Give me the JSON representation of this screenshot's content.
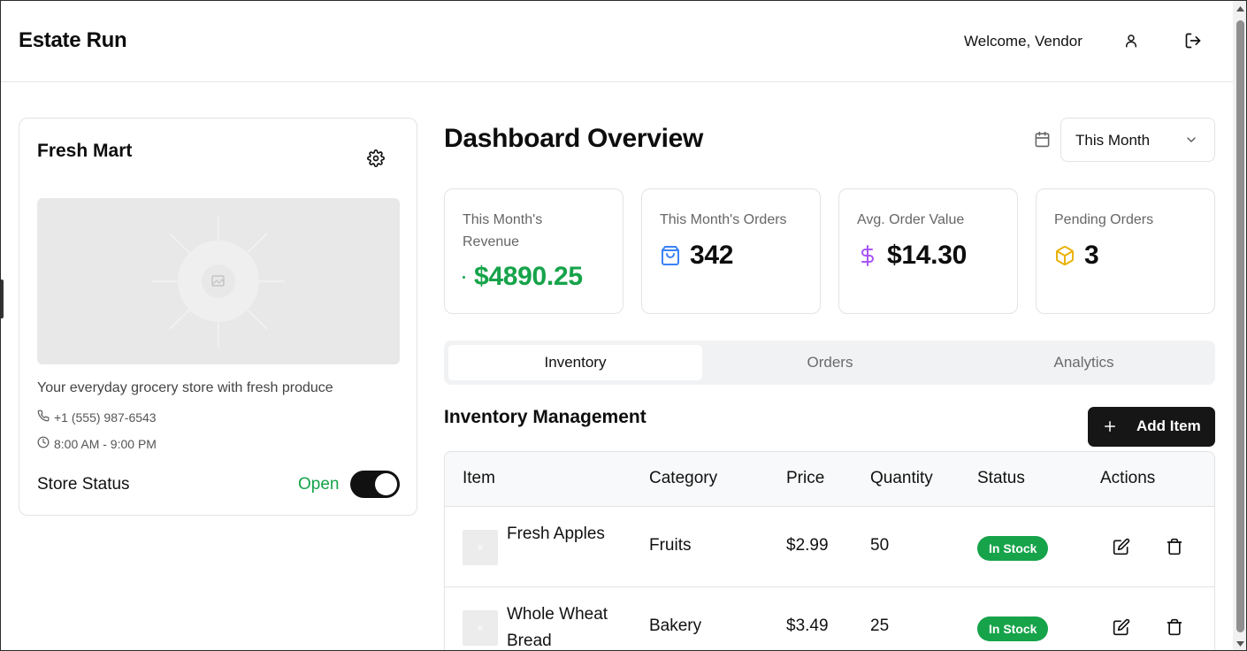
{
  "app": {
    "brand": "Estate Run",
    "welcome": "Welcome, Vendor",
    "icons": {
      "user": "user-icon",
      "logout": "logout-icon"
    }
  },
  "store": {
    "name": "Fresh Mart",
    "description": "Your everyday grocery store with fresh produce",
    "phone": "+1 (555) 987-6543",
    "hours": "8:00 AM - 9:00 PM",
    "status_label": "Store Status",
    "status_value": "Open",
    "status_on": true
  },
  "dashboard": {
    "title": "Dashboard Overview",
    "period": "This Month"
  },
  "stats": [
    {
      "label": "This Month's Revenue",
      "value": "$4890.25",
      "icon": "dot-icon",
      "color": "#16a34a"
    },
    {
      "label": "This Month's Orders",
      "value": "342",
      "icon": "shopping-bag-icon",
      "color": "#3b82f6"
    },
    {
      "label": "Avg. Order Value",
      "value": "$14.30",
      "icon": "dollar-icon",
      "color": "#a855f7"
    },
    {
      "label": "Pending Orders",
      "value": "3",
      "icon": "package-icon",
      "color": "#eab308"
    }
  ],
  "tabs": [
    "Inventory",
    "Orders",
    "Analytics"
  ],
  "active_tab": "Inventory",
  "inventory": {
    "title": "Inventory Management",
    "add_label": "Add Item",
    "columns": [
      "Item",
      "Category",
      "Price",
      "Quantity",
      "Status",
      "Actions"
    ],
    "rows": [
      {
        "item": "Fresh Apples",
        "category": "Fruits",
        "price": "$2.99",
        "quantity": "50",
        "status": "In Stock"
      },
      {
        "item": "Whole Wheat Bread",
        "category": "Bakery",
        "price": "$3.49",
        "quantity": "25",
        "status": "In Stock"
      }
    ]
  },
  "colors": {
    "accent": "#16a34a",
    "dark": "#161616"
  }
}
